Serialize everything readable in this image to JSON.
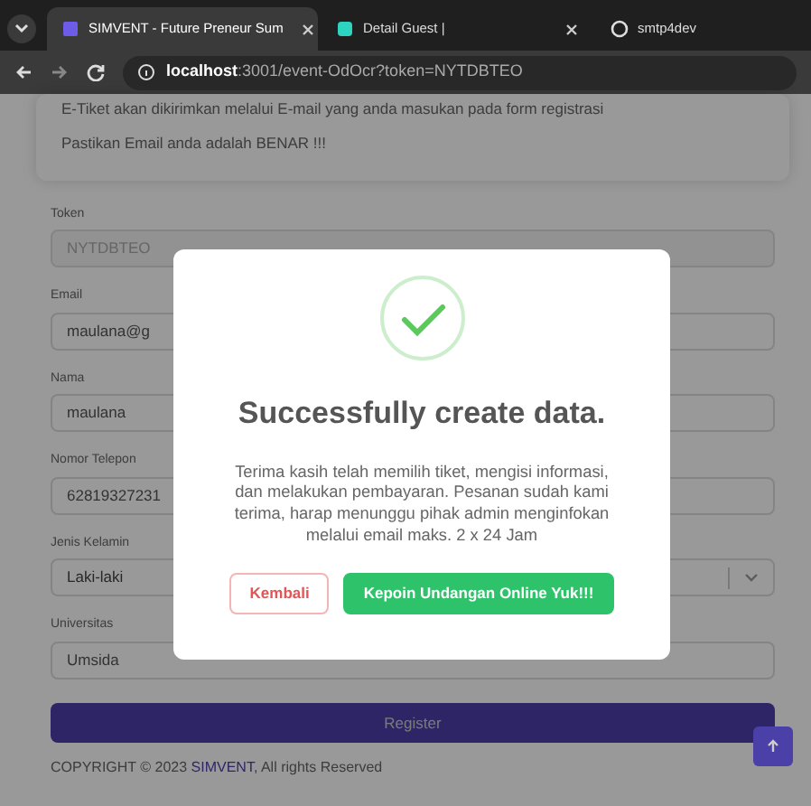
{
  "browser": {
    "tabs": [
      {
        "title": "SIMVENT - Future Preneur Sum",
        "selected": true,
        "closable": true
      },
      {
        "title": "Detail Guest |",
        "selected": false,
        "closable": true
      },
      {
        "title": "smtp4dev",
        "selected": false,
        "closable": false
      }
    ],
    "address": {
      "host": "localhost",
      "path": ":3001/event-OdOcr?token=NYTDBTEO"
    }
  },
  "notice": [
    "E-Tiket akan dikirimkan melalui E-mail yang anda masukan pada form registrasi",
    "Pastikan Email anda adalah BENAR !!!"
  ],
  "fields": [
    {
      "kind": "input",
      "label": "Token",
      "value": "NYTDBTEO",
      "disabled": true
    },
    {
      "kind": "input",
      "label": "Email",
      "value": "maulana@g",
      "disabled": false
    },
    {
      "kind": "input",
      "label": "Nama",
      "value": "maulana",
      "disabled": false
    },
    {
      "kind": "input",
      "label": "Nomor Telepon",
      "value": "62819327231",
      "disabled": false
    },
    {
      "kind": "select",
      "label": "Jenis Kelamin",
      "value": "Laki-laki",
      "disabled": false
    },
    {
      "kind": "input",
      "label": "Universitas",
      "value": "Umsida",
      "disabled": false
    }
  ],
  "register_button": "Register",
  "copyright": {
    "prefix": "COPYRIGHT © 2023 ",
    "link": "SIMVENT",
    "suffix": ", All rights Reserved"
  },
  "modal": {
    "title": "Successfully create data.",
    "message": "Terima kasih telah memilih tiket, mengisi informasi, dan melakukan pembayaran. Pesanan sudah kami terima, harap menunggu pihak admin menginfokan melalui email maks. 2 x 24 Jam",
    "buttons": [
      {
        "label": "Kembali",
        "kind": "outline"
      },
      {
        "label": "Kepoin Undangan Online Yuk!!!",
        "kind": "primary"
      }
    ]
  }
}
